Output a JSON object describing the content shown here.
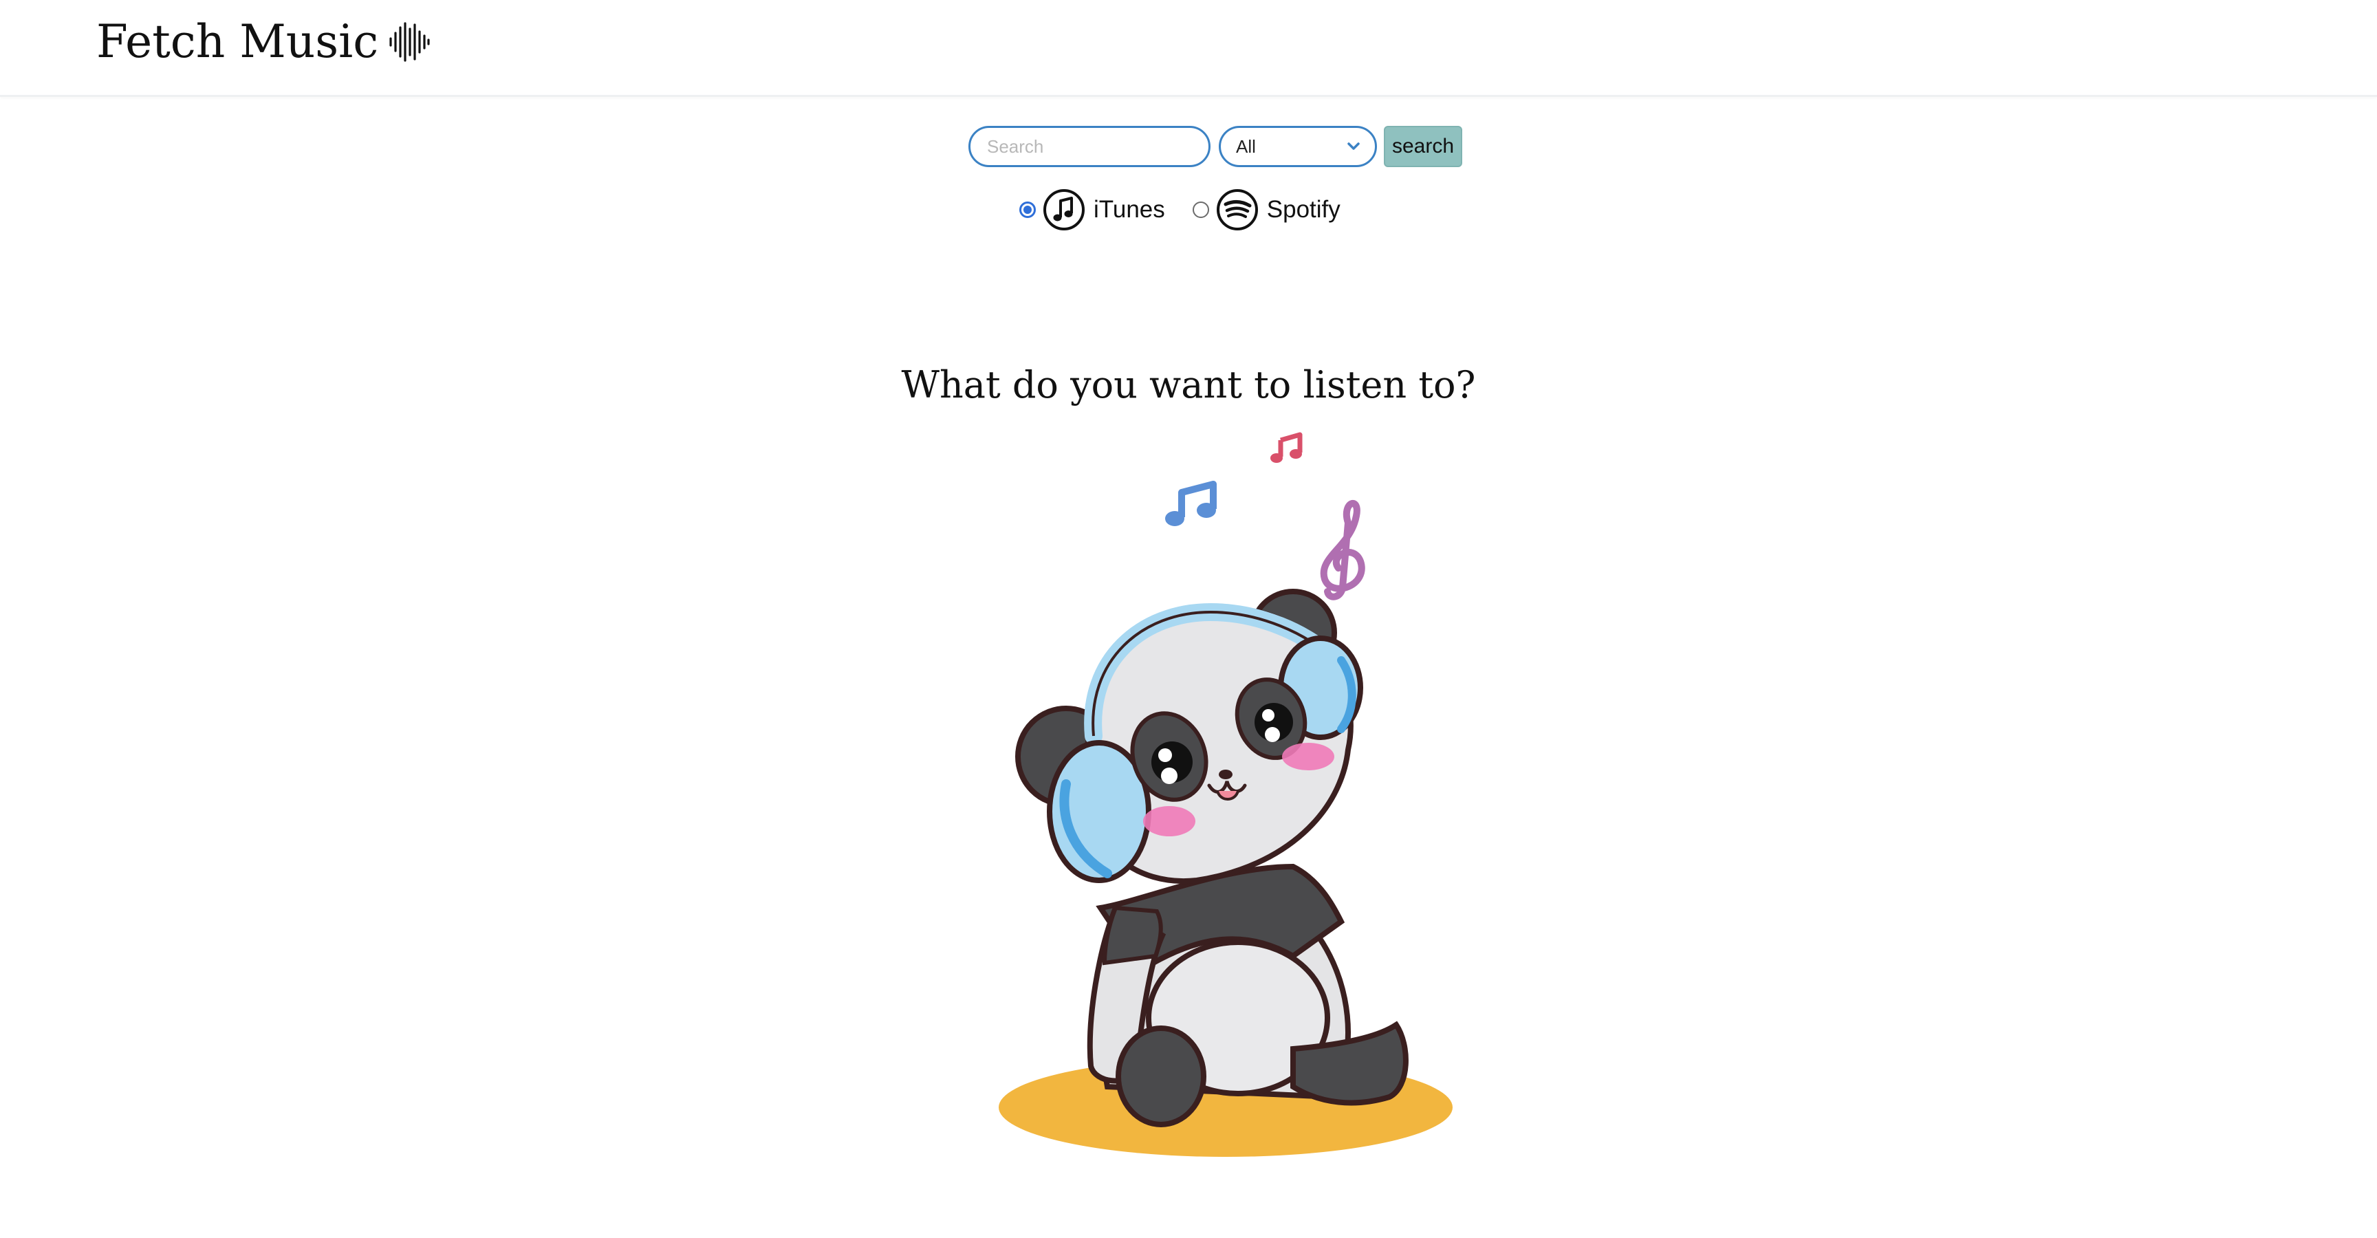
{
  "header": {
    "brand_title": "Fetch Music",
    "brand_icon": "sound-wave-icon"
  },
  "search": {
    "placeholder": "Search",
    "value": "",
    "filter_selected": "All",
    "button_label": "search"
  },
  "sources": [
    {
      "label": "iTunes",
      "icon": "music-note-icon",
      "checked": true
    },
    {
      "label": "Spotify",
      "icon": "spotify-icon",
      "checked": false
    }
  ],
  "main": {
    "prompt": "What do you want to listen to?",
    "illustration": "panda-with-headphones"
  },
  "colors": {
    "accent_blue": "#3b82c4",
    "button_teal": "#8fc1bf",
    "radio_blue": "#2f6fd9",
    "shadow_orange": "#f2b63f",
    "earmuff_blue": "#a8d8f2",
    "blush_pink": "#f07ab8"
  }
}
